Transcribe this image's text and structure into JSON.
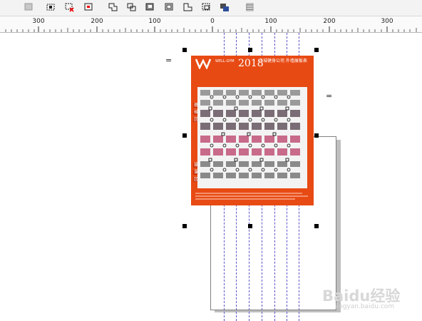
{
  "toolbar": {
    "tools": [
      "group-icon",
      "ungroup-icon",
      "ungroup-all-icon",
      "weld-icon",
      "trim-icon",
      "intersect-icon",
      "simplify-icon",
      "front-minus-back-icon",
      "back-minus-front-icon",
      "boundary-icon",
      "align-icon",
      "distribute-icon",
      "order-icon"
    ]
  },
  "ruler": {
    "labels": [
      "300",
      "200",
      "100",
      "0",
      "100",
      "200",
      "300"
    ]
  },
  "design": {
    "title": "2018",
    "logo_text": "WELL-GYM",
    "right_text": "古城健身公司 外墙展板表",
    "side_labels": [
      "器",
      "械",
      "区",
      "操",
      "课",
      "区"
    ]
  },
  "canvas": {
    "eq_left": "=",
    "eq_right": "="
  },
  "watermark": {
    "main": "Baidu经验",
    "sub": "jingyan.baidu.com"
  }
}
